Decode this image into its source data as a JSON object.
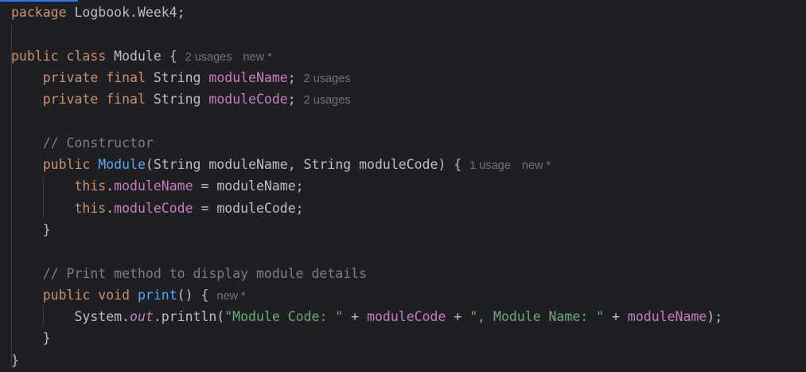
{
  "editor": {
    "lines": [
      {
        "tokens": [
          {
            "t": "kw",
            "v": "package"
          },
          {
            "t": "plain",
            "v": " Logbook.Week4;"
          }
        ],
        "hints": []
      },
      {
        "tokens": [],
        "hints": []
      },
      {
        "tokens": [
          {
            "t": "kw",
            "v": "public"
          },
          {
            "t": "plain",
            "v": " "
          },
          {
            "t": "kw",
            "v": "class"
          },
          {
            "t": "plain",
            "v": " Module {"
          }
        ],
        "hints": [
          "2 usages",
          "new *"
        ]
      },
      {
        "tokens": [
          {
            "t": "plain",
            "v": "    "
          },
          {
            "t": "kw",
            "v": "private"
          },
          {
            "t": "plain",
            "v": " "
          },
          {
            "t": "kw",
            "v": "final"
          },
          {
            "t": "plain",
            "v": " String "
          },
          {
            "t": "field",
            "v": "moduleName"
          },
          {
            "t": "plain",
            "v": ";"
          }
        ],
        "hints": [
          "2 usages"
        ]
      },
      {
        "tokens": [
          {
            "t": "plain",
            "v": "    "
          },
          {
            "t": "kw",
            "v": "private"
          },
          {
            "t": "plain",
            "v": " "
          },
          {
            "t": "kw",
            "v": "final"
          },
          {
            "t": "plain",
            "v": " String "
          },
          {
            "t": "field",
            "v": "moduleCode"
          },
          {
            "t": "plain",
            "v": ";"
          }
        ],
        "hints": [
          "2 usages"
        ]
      },
      {
        "tokens": [],
        "hints": []
      },
      {
        "tokens": [
          {
            "t": "plain",
            "v": "    "
          },
          {
            "t": "comment",
            "v": "// Constructor"
          }
        ],
        "hints": []
      },
      {
        "tokens": [
          {
            "t": "plain",
            "v": "    "
          },
          {
            "t": "kw",
            "v": "public"
          },
          {
            "t": "plain",
            "v": " "
          },
          {
            "t": "method",
            "v": "Module"
          },
          {
            "t": "plain",
            "v": "(String moduleName, String moduleCode) {"
          }
        ],
        "hints": [
          "1 usage",
          "new *"
        ]
      },
      {
        "tokens": [
          {
            "t": "plain",
            "v": "        "
          },
          {
            "t": "kw",
            "v": "this"
          },
          {
            "t": "plain",
            "v": "."
          },
          {
            "t": "field",
            "v": "moduleName"
          },
          {
            "t": "plain",
            "v": " = moduleName;"
          }
        ],
        "hints": []
      },
      {
        "tokens": [
          {
            "t": "plain",
            "v": "        "
          },
          {
            "t": "kw",
            "v": "this"
          },
          {
            "t": "plain",
            "v": "."
          },
          {
            "t": "field",
            "v": "moduleCode"
          },
          {
            "t": "plain",
            "v": " = moduleCode;"
          }
        ],
        "hints": []
      },
      {
        "tokens": [
          {
            "t": "plain",
            "v": "    }"
          }
        ],
        "hints": []
      },
      {
        "tokens": [],
        "hints": []
      },
      {
        "tokens": [
          {
            "t": "plain",
            "v": "    "
          },
          {
            "t": "comment",
            "v": "// Print method to display module details"
          }
        ],
        "hints": []
      },
      {
        "tokens": [
          {
            "t": "plain",
            "v": "    "
          },
          {
            "t": "kw",
            "v": "public"
          },
          {
            "t": "plain",
            "v": " "
          },
          {
            "t": "kw",
            "v": "void"
          },
          {
            "t": "plain",
            "v": " "
          },
          {
            "t": "method",
            "v": "print"
          },
          {
            "t": "plain",
            "v": "() {"
          }
        ],
        "hints": [
          "new *"
        ]
      },
      {
        "tokens": [
          {
            "t": "plain",
            "v": "        System."
          },
          {
            "t": "static-field",
            "v": "out"
          },
          {
            "t": "plain",
            "v": ".println("
          },
          {
            "t": "string",
            "v": "\"Module Code: \""
          },
          {
            "t": "plain",
            "v": " + "
          },
          {
            "t": "field",
            "v": "moduleCode"
          },
          {
            "t": "plain",
            "v": " + "
          },
          {
            "t": "string",
            "v": "\", Module Name: \""
          },
          {
            "t": "plain",
            "v": " + "
          },
          {
            "t": "field",
            "v": "moduleName"
          },
          {
            "t": "plain",
            "v": ");"
          }
        ],
        "hints": []
      },
      {
        "tokens": [
          {
            "t": "plain",
            "v": "    }"
          }
        ],
        "hints": []
      },
      {
        "tokens": [
          {
            "t": "plain",
            "v": "}"
          }
        ],
        "hints": []
      }
    ]
  }
}
